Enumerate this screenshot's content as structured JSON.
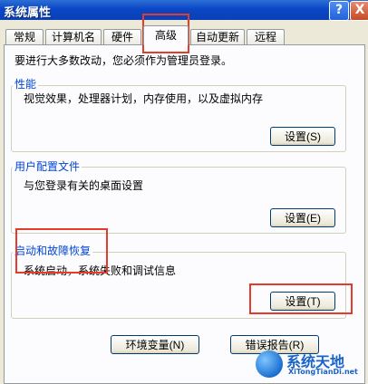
{
  "window": {
    "title": "系统属性",
    "help_glyph": "?",
    "close_glyph": "X"
  },
  "tabs": [
    {
      "label": "常规"
    },
    {
      "label": "计算机名"
    },
    {
      "label": "硬件"
    },
    {
      "label": "高级",
      "active": true
    },
    {
      "label": "自动更新"
    },
    {
      "label": "远程"
    }
  ],
  "notice": "要进行大多数改动，您必须作为管理员登录。",
  "groups": {
    "performance": {
      "legend": "性能",
      "description": "视觉效果，处理器计划，内存使用，以及虚拟内存",
      "button": "设置(S)"
    },
    "user_profiles": {
      "legend": "用户配置文件",
      "description": "与您登录有关的桌面设置",
      "button": "设置(E)"
    },
    "startup_recovery": {
      "legend": "启动和故障恢复",
      "description": "系统启动，系统失败和调试信息",
      "button": "设置(T)"
    }
  },
  "bottom_buttons": {
    "env_vars": "环境变量(N)",
    "error_report": "错误报告(R)"
  },
  "watermark": {
    "title": "系统天地",
    "subtitle": "XiTongTianDi.net"
  },
  "colors": {
    "highlight": "#e53b2a",
    "legend": "#0046d5",
    "titlebar": "#0a47c6"
  }
}
